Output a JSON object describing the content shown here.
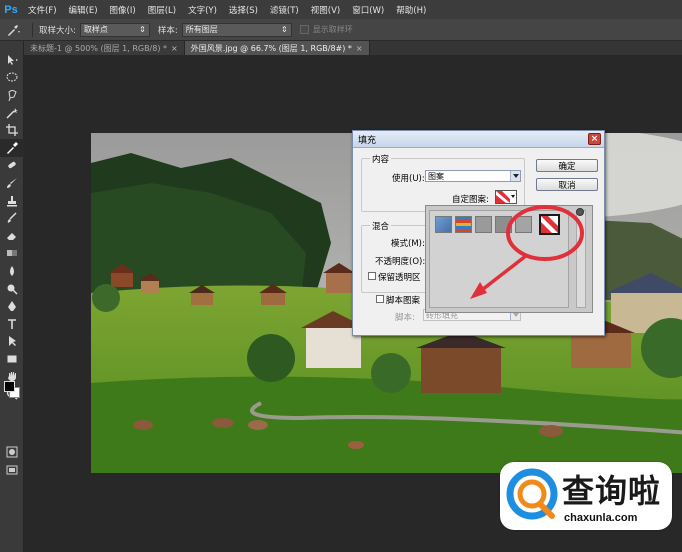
{
  "app": {
    "logo": "Ps"
  },
  "menu": [
    "文件(F)",
    "编辑(E)",
    "图像(I)",
    "图层(L)",
    "文字(Y)",
    "选择(S)",
    "滤镜(T)",
    "视图(V)",
    "窗口(W)",
    "帮助(H)"
  ],
  "options": {
    "sample_size_label": "取样大小:",
    "sample_size_value": "取样点",
    "sample_label": "样本:",
    "sample_value": "所有图层",
    "show_ring_label": "显示取样环"
  },
  "tabs": [
    {
      "label": "未标题-1 @ 500% (图层 1, RGB/8) *",
      "close": "×"
    },
    {
      "label": "外国风景.jpg @ 66.7% (图层 1, RGB/8#) *",
      "close": "×"
    }
  ],
  "tools": [
    "move-icon",
    "marquee-icon",
    "lasso-icon",
    "magic-wand-icon",
    "crop-icon",
    "eyedropper-icon",
    "healing-brush-icon",
    "brush-icon",
    "clone-stamp-icon",
    "history-brush-icon",
    "eraser-icon",
    "gradient-icon",
    "blur-icon",
    "dodge-icon",
    "pen-icon",
    "type-icon",
    "path-selection-icon",
    "rectangle-icon",
    "hand-icon",
    "zoom-icon"
  ],
  "colors": {
    "foreground": "#000000",
    "background": "#ffffff",
    "annotation": "#e0303a"
  },
  "dialog": {
    "title": "填充",
    "close": "×",
    "content_group": "内容",
    "use_label": "使用(U):",
    "use_value": "图案",
    "custom_pattern_label": "自定图案:",
    "blend_group": "混合",
    "mode_label": "模式(M):",
    "opacity_label": "不透明度(O):",
    "preserve_label": "保留透明区",
    "script_label": "脚本图案",
    "script_sub_label": "脚本:",
    "script_value": "砖形填充",
    "ok_label": "确定",
    "cancel_label": "取消"
  },
  "watermark": {
    "text": "查询啦",
    "url": "chaxunla.com"
  }
}
